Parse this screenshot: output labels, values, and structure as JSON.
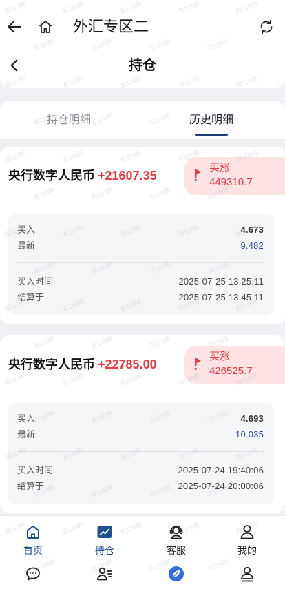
{
  "browser_bar": {
    "title": "外汇专区二",
    "back_icon": "arrow-left-icon",
    "home_icon": "home-icon",
    "refresh_icon": "refresh-icon"
  },
  "page_header": {
    "title": "持仓",
    "back_icon": "chevron-left-icon"
  },
  "tabs": [
    {
      "label": "持仓明细",
      "active": false
    },
    {
      "label": "历史明细",
      "active": true
    }
  ],
  "labels": {
    "buy": "买入",
    "latest": "最新",
    "buy_time": "买入时间",
    "settled": "结算于"
  },
  "positions": [
    {
      "name": "央行数字人民币",
      "profit": "+21607.35",
      "direction": "买涨",
      "direction_icon": "flag-up-icon",
      "amount": "449310.7",
      "buy_price": "4.673",
      "latest_price": "9.482",
      "buy_time": "2025-07-25 13:25:11",
      "settle_time": "2025-07-25 13:45:11"
    },
    {
      "name": "央行数字人民币",
      "profit": "+22785.00",
      "direction": "买涨",
      "direction_icon": "flag-up-icon",
      "amount": "426525.7",
      "buy_price": "4.693",
      "latest_price": "10.035",
      "buy_time": "2025-07-24 19:40:06",
      "settle_time": "2025-07-24 20:00:06"
    }
  ],
  "bottom_nav": {
    "primary": [
      {
        "label": "首页",
        "icon": "home-icon",
        "active": true
      },
      {
        "label": "持仓",
        "icon": "chart-icon",
        "active": true
      },
      {
        "label": "客服",
        "icon": "headset-icon",
        "active": false
      },
      {
        "label": "我的",
        "icon": "user-icon",
        "active": false
      }
    ],
    "secondary": [
      {
        "icon": "chat-icon",
        "active": false
      },
      {
        "icon": "contacts-icon",
        "active": false
      },
      {
        "icon": "discover-icon",
        "active": true
      },
      {
        "icon": "user-icon",
        "active": false
      }
    ]
  },
  "watermark": "双110网",
  "colors": {
    "profit_red": "#e8383d",
    "badge_bg": "#fde3e4",
    "nav_active": "#1d4f91",
    "latest_price_blue": "#2b4c9b",
    "tab_underline": "#1e3a78",
    "page_bg": "#f0f1f4"
  }
}
